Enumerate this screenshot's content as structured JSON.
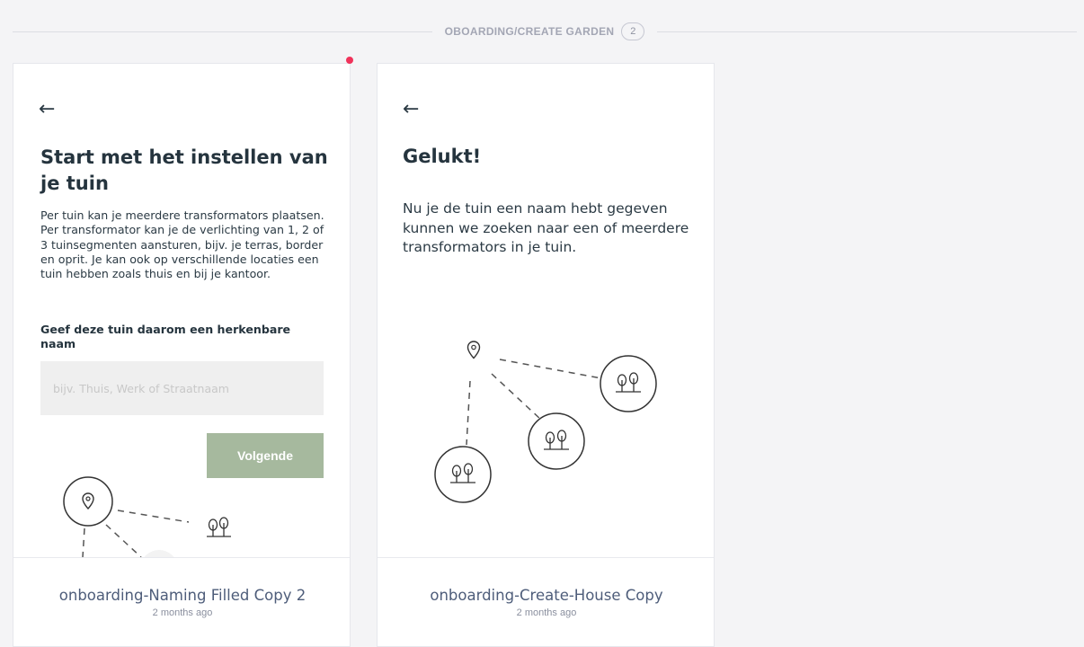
{
  "section": {
    "title": "OBOARDING/CREATE GARDEN",
    "count": "2"
  },
  "cards": [
    {
      "screen": {
        "back": "←",
        "title": "Start met het instellen van je tuin",
        "body": "Per tuin kan je meerdere transformators plaatsen. Per transformator kan je de verlichting van 1, 2 of 3 tuinsegmenten aansturen, bijv. je terras, border en oprit. Je kan ook op verschillende locaties een tuin hebben zoals thuis en bij je kantoor.",
        "label": "Geef deze tuin daarom een herkenbare naam",
        "input_placeholder": "bijv. Thuis, Werk of Straatnaam",
        "input_value": "",
        "button": "Volgende"
      },
      "name": "onboarding-Naming Filled Copy 2",
      "time": "2 months ago"
    },
    {
      "screen": {
        "back": "←",
        "title": "Gelukt!",
        "body": "Nu je de tuin een naam hebt gegeven kunnen we zoeken naar een of meerdere transformators in je tuin."
      },
      "name": "onboarding-Create-House Copy",
      "time": "2 months ago"
    }
  ],
  "colors": {
    "accent": "#a6b99e",
    "unread_dot": "#f0325a",
    "background": "#f4f4f6"
  },
  "icons": [
    "back-arrow-icon",
    "location-pin-icon",
    "trees-icon"
  ]
}
